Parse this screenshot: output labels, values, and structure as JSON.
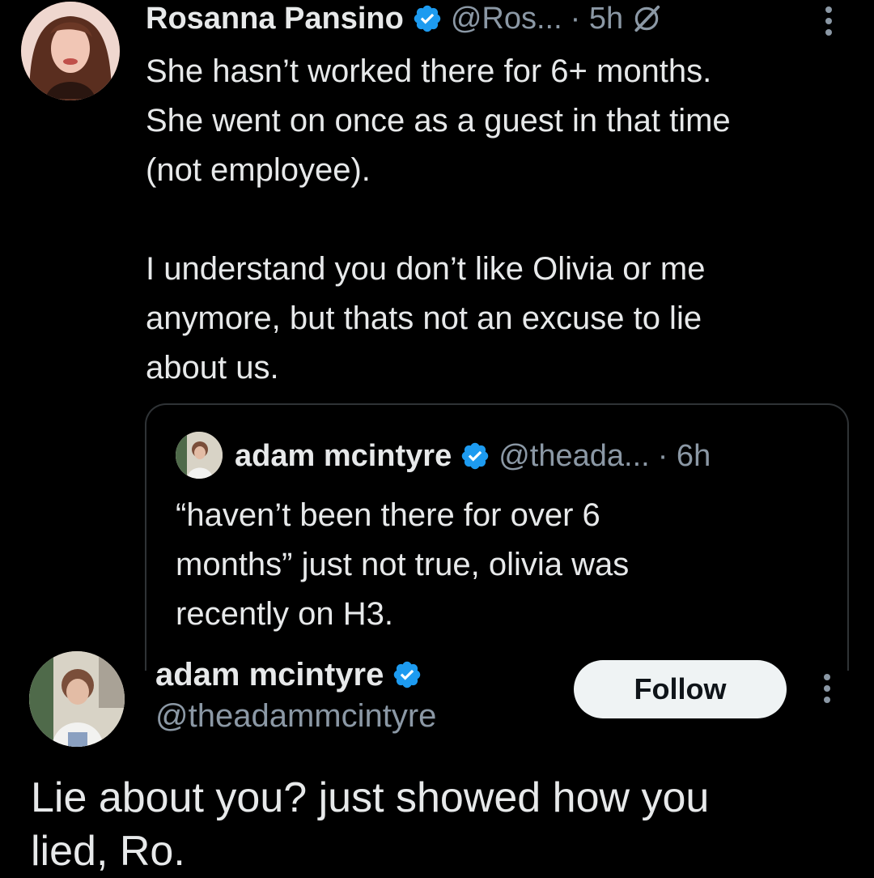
{
  "parent_tweet": {
    "author_name": "Rosanna Pansino",
    "handle": "@Ros...",
    "time": "· 5h",
    "body": "She hasn’t worked there for 6+ months. \nShe went on once as a guest in that time \n(not employee).\n\nI understand you don’t like Olivia or me \nanymore, but thats not an excuse to lie \nabout us."
  },
  "quoted_tweet": {
    "author_name": "adam mcintyre",
    "handle": "@theada...",
    "time": "· 6h",
    "body": "“haven’t been there for over 6 \nmonths” just not true, olivia was \nrecently on H3."
  },
  "reply_tweet": {
    "author_name": "adam mcintyre",
    "handle": "@theadammcintyre",
    "follow_label": "Follow",
    "body": "Lie about you? just showed how you \nlied, Ro."
  },
  "colors": {
    "background": "#000000",
    "text_primary": "#e7e9ea",
    "text_secondary": "#8b98a5",
    "verified_blue": "#1d9bf0",
    "border": "#2f3336",
    "follow_bg": "#eff3f4"
  },
  "icons": {
    "verified": "verified-badge-icon",
    "grok": "grok-icon",
    "more": "more-vertical-icon"
  }
}
